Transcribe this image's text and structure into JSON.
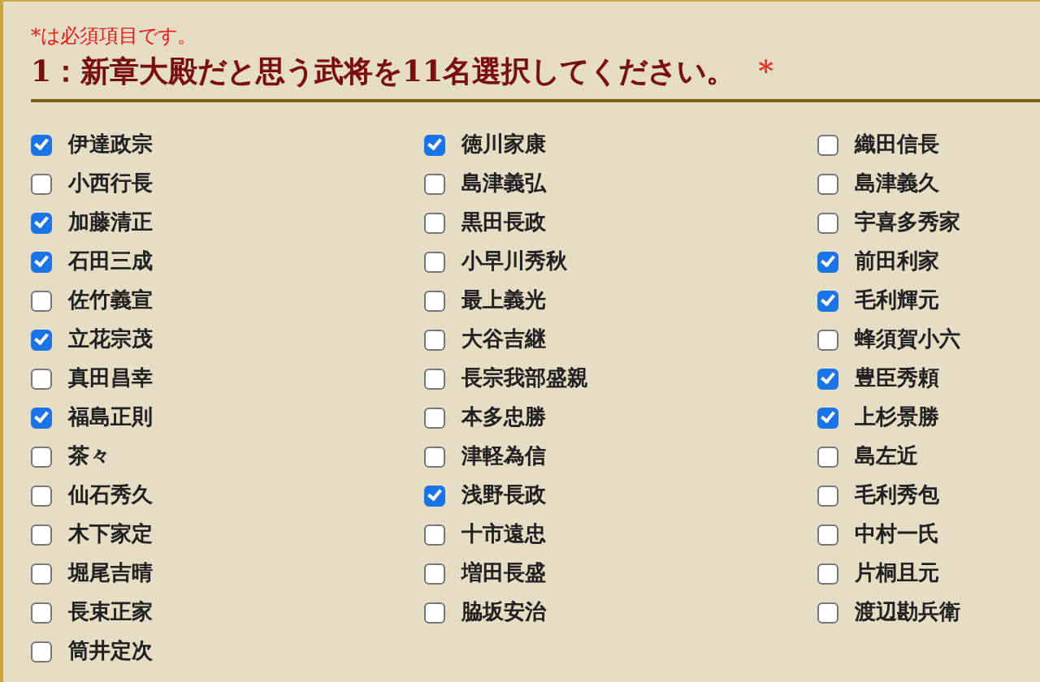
{
  "required_note": "*は必須項目です。",
  "question": {
    "title": "1：新章大殿だと思う武将を11名選択してください。",
    "required_mark": "*"
  },
  "options": [
    {
      "label": "伊達政宗",
      "checked": true
    },
    {
      "label": "徳川家康",
      "checked": true
    },
    {
      "label": "織田信長",
      "checked": false
    },
    {
      "label": "小西行長",
      "checked": false
    },
    {
      "label": "島津義弘",
      "checked": false
    },
    {
      "label": "島津義久",
      "checked": false
    },
    {
      "label": "加藤清正",
      "checked": true
    },
    {
      "label": "黒田長政",
      "checked": false
    },
    {
      "label": "宇喜多秀家",
      "checked": false
    },
    {
      "label": "石田三成",
      "checked": true
    },
    {
      "label": "小早川秀秋",
      "checked": false
    },
    {
      "label": "前田利家",
      "checked": true
    },
    {
      "label": "佐竹義宣",
      "checked": false
    },
    {
      "label": "最上義光",
      "checked": false
    },
    {
      "label": "毛利輝元",
      "checked": true
    },
    {
      "label": "立花宗茂",
      "checked": true
    },
    {
      "label": "大谷吉継",
      "checked": false
    },
    {
      "label": "蜂須賀小六",
      "checked": false
    },
    {
      "label": "真田昌幸",
      "checked": false
    },
    {
      "label": "長宗我部盛親",
      "checked": false
    },
    {
      "label": "豊臣秀頼",
      "checked": true
    },
    {
      "label": "福島正則",
      "checked": true
    },
    {
      "label": "本多忠勝",
      "checked": false
    },
    {
      "label": "上杉景勝",
      "checked": true
    },
    {
      "label": "茶々",
      "checked": false
    },
    {
      "label": "津軽為信",
      "checked": false
    },
    {
      "label": "島左近",
      "checked": false
    },
    {
      "label": "仙石秀久",
      "checked": false
    },
    {
      "label": "浅野長政",
      "checked": true
    },
    {
      "label": "毛利秀包",
      "checked": false
    },
    {
      "label": "木下家定",
      "checked": false
    },
    {
      "label": "十市遠忠",
      "checked": false
    },
    {
      "label": "中村一氏",
      "checked": false
    },
    {
      "label": "堀尾吉晴",
      "checked": false
    },
    {
      "label": "増田長盛",
      "checked": false
    },
    {
      "label": "片桐且元",
      "checked": false
    },
    {
      "label": "長束正家",
      "checked": false
    },
    {
      "label": "脇坂安治",
      "checked": false
    },
    {
      "label": "渡辺勘兵衛",
      "checked": false
    },
    {
      "label": "筒井定次",
      "checked": false
    }
  ]
}
